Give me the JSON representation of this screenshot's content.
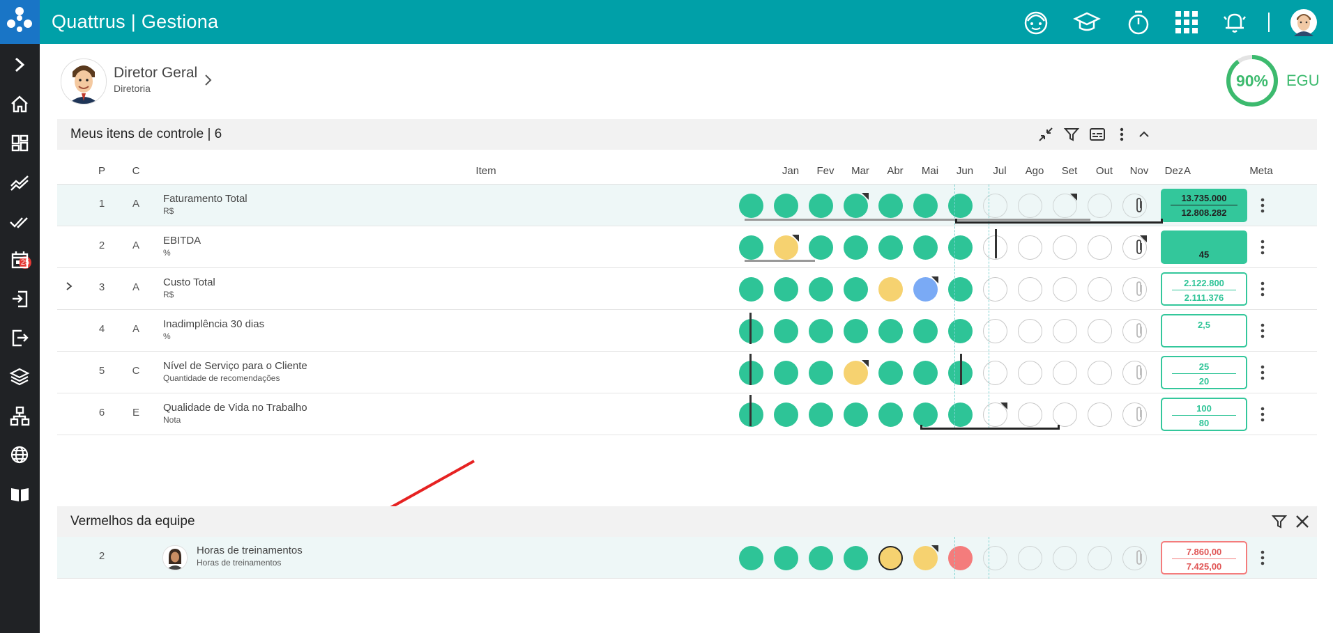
{
  "app": {
    "title": "Quattrus | Gestiona"
  },
  "topbar_icons": [
    "baby-face-icon",
    "graduation-cap-icon",
    "stopwatch-icon",
    "apps-grid-icon",
    "bell-alarm-icon",
    "avatar"
  ],
  "sidebar": {
    "icons": [
      "expand-chevron-icon",
      "home-icon",
      "dashboard-icon",
      "chart-trend-icon",
      "checks-icon",
      "calendar-icon",
      "login-icon",
      "logout-icon",
      "layers-icon",
      "hierarchy-icon",
      "globe-icon",
      "book-icon"
    ],
    "badge": "25"
  },
  "user": {
    "name": "Diretor Geral",
    "role": "Diretoria"
  },
  "score": {
    "value": "90%",
    "percent": 90,
    "unit": "EGU",
    "color": "#3cba6e"
  },
  "controls": {
    "title": "Meus itens de controle | 6",
    "columns": {
      "p": "P",
      "c": "C",
      "item": "Item",
      "a": "A",
      "meta": "Meta"
    },
    "months": [
      "Jan",
      "Fev",
      "Mar",
      "Abr",
      "Mai",
      "Jun",
      "Jul",
      "Ago",
      "Set",
      "Out",
      "Nov",
      "Dez"
    ],
    "rows": [
      {
        "p": "1",
        "c": "A",
        "title": "Faturamento Total",
        "sub": "R$",
        "meta_top": "13.735.000",
        "meta_bot": "12.808.282"
      },
      {
        "p": "2",
        "c": "A",
        "title": "EBITDA",
        "sub": "%",
        "meta_top": "",
        "meta_bot": "45"
      },
      {
        "p": "3",
        "c": "A",
        "title": "Custo Total",
        "sub": "R$",
        "meta_top": "2.122.800",
        "meta_bot": "2.111.376"
      },
      {
        "p": "4",
        "c": "A",
        "title": "Inadimplência 30 dias",
        "sub": "%",
        "meta_top": "2,5",
        "meta_bot": ""
      },
      {
        "p": "5",
        "c": "C",
        "title": "Nível de Serviço para o Cliente",
        "sub": "Quantidade de recomendações",
        "meta_top": "25",
        "meta_bot": "20"
      },
      {
        "p": "6",
        "c": "E",
        "title": "Qualidade de Vida no Trabalho",
        "sub": "Nota",
        "meta_top": "100",
        "meta_bot": "80"
      }
    ]
  },
  "team": {
    "title": "Vermelhos da equipe",
    "rows": [
      {
        "p": "2",
        "title": "Horas de treinamentos",
        "sub": "Horas de treinamentos",
        "meta_top": "7.860,00",
        "meta_bot": "7.425,00"
      }
    ]
  },
  "colors": {
    "green": "#2ec497",
    "yellow": "#f6d270",
    "blue": "#7aaaf5",
    "red": "#f47c7c",
    "teal": "#00a0a8"
  }
}
